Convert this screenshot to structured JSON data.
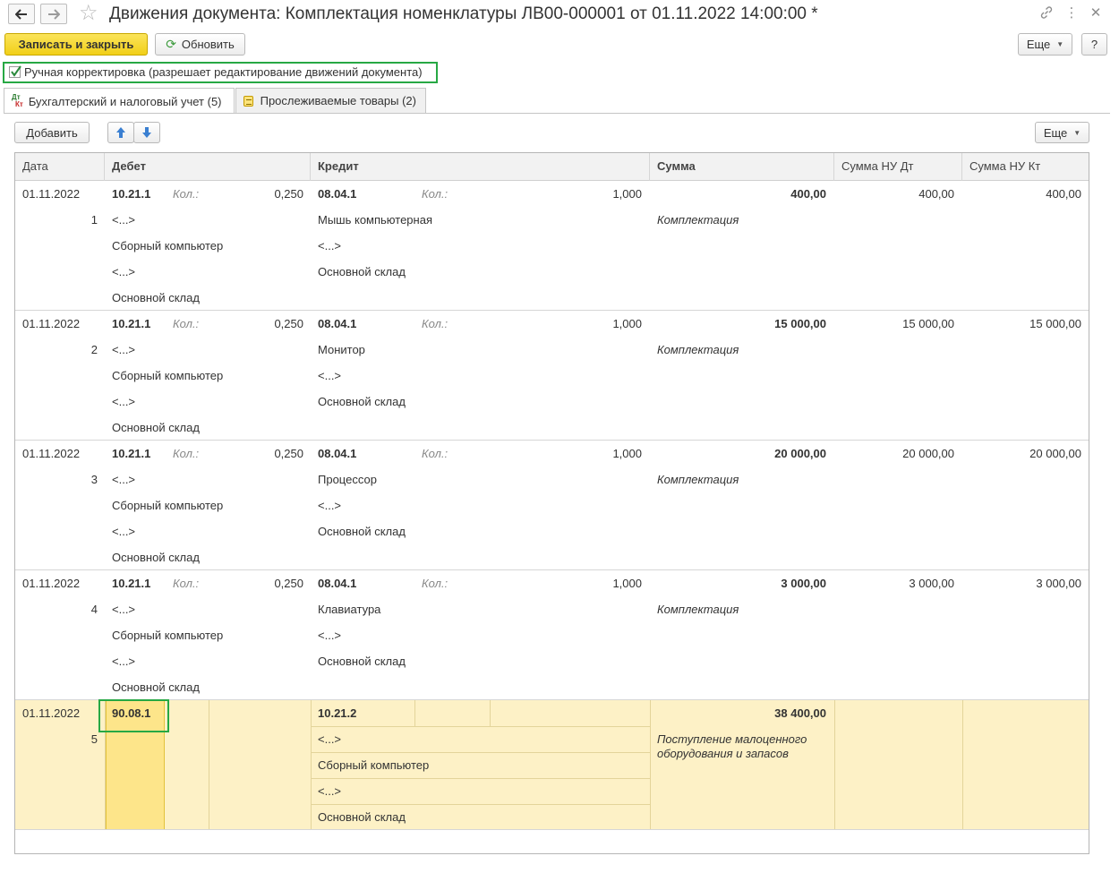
{
  "window": {
    "title": "Движения документа: Комплектация номенклатуры ЛВ00-000001 от 01.11.2022 14:00:00 *"
  },
  "toolbar": {
    "save_close_label": "Записать и закрыть",
    "refresh_label": "Обновить",
    "more_label": "Еще",
    "help_label": "?"
  },
  "manual": {
    "label": "Ручная корректировка (разрешает редактирование движений документа)",
    "checked": true
  },
  "tabs": [
    {
      "label": "Бухгалтерский и налоговый учет (5)",
      "active": true
    },
    {
      "label": "Прослеживаемые товары (2)",
      "active": false
    }
  ],
  "grid_toolbar": {
    "add_label": "Добавить",
    "more_label": "Еще"
  },
  "table": {
    "columns": [
      "Дата",
      "Дебет",
      "Кредит",
      "Сумма",
      "Сумма НУ Дт",
      "Сумма НУ Кт"
    ],
    "qty_label": "Кол.:",
    "rows": [
      {
        "date": "01.11.2022",
        "num": "1",
        "debit_account": "10.21.1",
        "debit_qty": "0,250",
        "debit_sub": [
          "<...>",
          "Сборный компьютер",
          "<...>",
          "Основной склад"
        ],
        "credit_account": "08.04.1",
        "credit_qty": "1,000",
        "credit_sub": [
          "Мышь компьютерная",
          "<...>",
          "Основной склад"
        ],
        "sum": "400,00",
        "content": "Комплектация",
        "nu_dt": "400,00",
        "nu_kt": "400,00"
      },
      {
        "date": "01.11.2022",
        "num": "2",
        "debit_account": "10.21.1",
        "debit_qty": "0,250",
        "debit_sub": [
          "<...>",
          "Сборный компьютер",
          "<...>",
          "Основной склад"
        ],
        "credit_account": "08.04.1",
        "credit_qty": "1,000",
        "credit_sub": [
          "Монитор",
          "<...>",
          "Основной склад"
        ],
        "sum": "15 000,00",
        "content": "Комплектация",
        "nu_dt": "15 000,00",
        "nu_kt": "15 000,00"
      },
      {
        "date": "01.11.2022",
        "num": "3",
        "debit_account": "10.21.1",
        "debit_qty": "0,250",
        "debit_sub": [
          "<...>",
          "Сборный компьютер",
          "<...>",
          "Основной склад"
        ],
        "credit_account": "08.04.1",
        "credit_qty": "1,000",
        "credit_sub": [
          "Процессор",
          "<...>",
          "Основной склад"
        ],
        "sum": "20 000,00",
        "content": "Комплектация",
        "nu_dt": "20 000,00",
        "nu_kt": "20 000,00"
      },
      {
        "date": "01.11.2022",
        "num": "4",
        "debit_account": "10.21.1",
        "debit_qty": "0,250",
        "debit_sub": [
          "<...>",
          "Сборный компьютер",
          "<...>",
          "Основной склад"
        ],
        "credit_account": "08.04.1",
        "credit_qty": "1,000",
        "credit_sub": [
          "Клавиатура",
          "<...>",
          "Основной склад"
        ],
        "sum": "3 000,00",
        "content": "Комплектация",
        "nu_dt": "3 000,00",
        "nu_kt": "3 000,00"
      },
      {
        "date": "01.11.2022",
        "num": "5",
        "debit_account": "90.08.1",
        "credit_account": "10.21.2",
        "credit_sub": [
          "<...>",
          "Сборный компьютер",
          "<...>",
          "Основной склад"
        ],
        "sum": "38 400,00",
        "content_lines": [
          "Поступление малоценного",
          "оборудования и запасов"
        ]
      }
    ]
  },
  "colors": {
    "primary_button": "#f1cf18",
    "highlight_frame": "#27a844",
    "selected_row": "#fdf1c6",
    "selected_cell": "#fde58a"
  }
}
